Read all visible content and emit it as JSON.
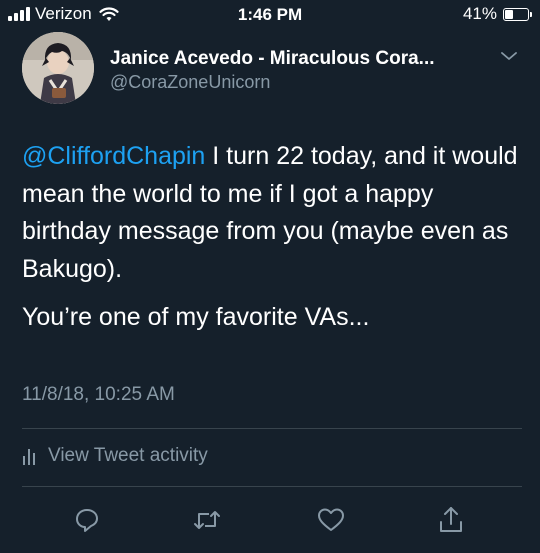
{
  "status_bar": {
    "carrier": "Verizon",
    "time": "1:46 PM",
    "battery_percent": "41%",
    "battery_level": 0.41
  },
  "tweet": {
    "author": {
      "display_name": "Janice Acevedo - Miraculous Cora...",
      "handle": "@CoraZoneUnicorn",
      "avatar": "avatar-illustration"
    },
    "mention": "@CliffordChapin",
    "body_line1": " I turn 22 today, and it would mean the world to me if I got a happy birthday message from you (maybe even as Bakugo).",
    "body_line2": "You’re one of my favorite VAs...",
    "timestamp": "11/8/18, 10:25 AM",
    "activity_label": "View Tweet activity"
  },
  "actions": [
    "reply-icon",
    "retweet-icon",
    "like-icon",
    "share-icon"
  ],
  "colors": {
    "background": "#15202b",
    "text": "#ffffff",
    "secondary_text": "#8899a6",
    "mention": "#1da1f2",
    "divider": "#38444d"
  }
}
